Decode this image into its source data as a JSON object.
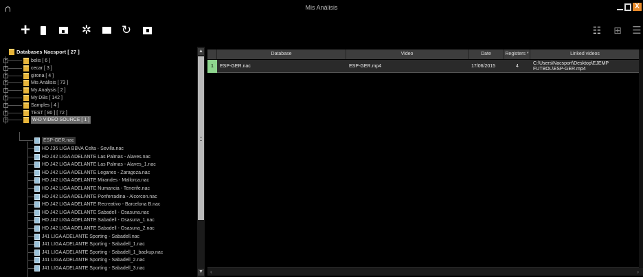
{
  "app": {
    "title": "Mis Análisis",
    "logo": "∩"
  },
  "window_controls": {
    "close_label": "X"
  },
  "toolbar": {
    "add_icon": "plus-icon",
    "plus_glyph": "+",
    "gear_glyph": "✲",
    "sync_glyph": "↻",
    "view1_glyph": "☷",
    "view2_glyph": "⊞",
    "view3_glyph": "☰"
  },
  "tree": {
    "root_label": "Databases Nacsport [ 27 ]",
    "folders": [
      {
        "label": "belis [ 6 ]"
      },
      {
        "label": "cecar [ 3 ]"
      },
      {
        "label": "girona [ 4 ]"
      },
      {
        "label": "Mis Análisis [ 73 ]"
      },
      {
        "label": "My Analysis [ 2 ]"
      },
      {
        "label": "My DBs [ 142 ]"
      },
      {
        "label": "Samples [ 4 ]"
      },
      {
        "label": "TEST [ 80 ] [ 72 ]"
      },
      {
        "label": "W-D VIDEO SOURCE [ 1 ]"
      }
    ],
    "selected_child": "ESP-GER.nac",
    "files": [
      "HD J36 LIGA BBVA Celta - Sevilla.nac",
      "HD J42 LIGA ADELANTE Las Palmas - Alaves.nac",
      "HD J42 LIGA ADELANTE Las Palmas - Alaves_1.nac",
      "HD J42 LIGA ADELANTE Leganes - Zaragoza.nac",
      "HD J42 LIGA ADELANTE Mirandes - Mallorca.nac",
      "HD J42 LIGA ADELANTE Numancia - Tenerife.nac",
      "HD J42 LIGA ADELANTE Ponferradina - Alcorcon.nac",
      "HD J42 LIGA ADELANTE Recreativo - Barcelona B.nac",
      "HD J42 LIGA ADELANTE Sabadell - Osasuna.nac",
      "HD J42 LIGA ADELANTE Sabadell - Osasuna_1.nac",
      "HD J42 LIGA ADELANTE Sabadell - Osasuna_2.nac",
      "J41 LIGA ADELANTE Sporting - Sabadell.nac",
      "J41 LIGA ADELANTE Sporting - Sabadell_1.nac",
      "J41 LIGA ADELANTE Sporting - Sabadell_1_backup.nac",
      "J41 LIGA ADELANTE Sporting - Sabadell_2.nac",
      "J41 LIGA ADELANTE Sporting - Sabadell_3.nac"
    ]
  },
  "grid": {
    "columns": [
      "Database",
      "Video",
      "Date",
      "Registers *",
      "Linked videos"
    ],
    "rows": [
      {
        "num": "1",
        "database": "ESP-GER.nac",
        "video": "ESP-GER.mp4",
        "date": "17/06/2015",
        "registers": "4",
        "linked": "C:\\Users\\Nacsport\\Desktop\\EJEMP FUTBOL\\ESP-GER.mp4"
      }
    ]
  }
}
